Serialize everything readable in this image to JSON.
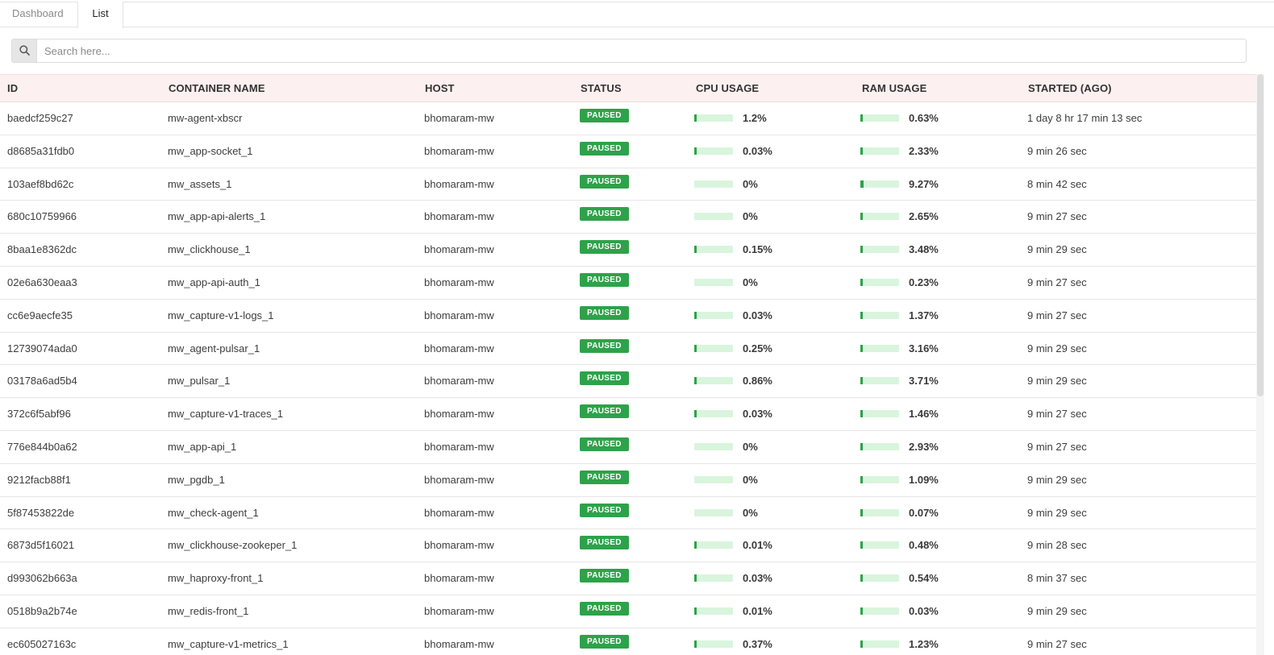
{
  "tabs": [
    {
      "label": "Dashboard",
      "active": false
    },
    {
      "label": "List",
      "active": true
    }
  ],
  "search": {
    "placeholder": "Search here...",
    "value": ""
  },
  "colors": {
    "status_paused": "#2ea24a",
    "meter_track": "#d9f5dd",
    "header_bg": "#fdf0f0"
  },
  "table": {
    "columns": [
      "ID",
      "CONTAINER NAME",
      "HOST",
      "STATUS",
      "CPU USAGE",
      "RAM USAGE",
      "STARTED (AGO)"
    ],
    "rows": [
      {
        "id": "baedcf259c27",
        "name": "mw-agent-xbscr",
        "host": "bhomaram-mw",
        "status": "PAUSED",
        "cpu": "1.2%",
        "cpu_value": 1.2,
        "ram": "0.63%",
        "ram_value": 0.63,
        "started": "1 day 8 hr 17 min 13 sec"
      },
      {
        "id": "d8685a31fdb0",
        "name": "mw_app-socket_1",
        "host": "bhomaram-mw",
        "status": "PAUSED",
        "cpu": "0.03%",
        "cpu_value": 0.03,
        "ram": "2.33%",
        "ram_value": 2.33,
        "started": "9 min 26 sec"
      },
      {
        "id": "103aef8bd62c",
        "name": "mw_assets_1",
        "host": "bhomaram-mw",
        "status": "PAUSED",
        "cpu": "0%",
        "cpu_value": 0,
        "ram": "9.27%",
        "ram_value": 9.27,
        "started": "8 min 42 sec"
      },
      {
        "id": "680c10759966",
        "name": "mw_app-api-alerts_1",
        "host": "bhomaram-mw",
        "status": "PAUSED",
        "cpu": "0%",
        "cpu_value": 0,
        "ram": "2.65%",
        "ram_value": 2.65,
        "started": "9 min 27 sec"
      },
      {
        "id": "8baa1e8362dc",
        "name": "mw_clickhouse_1",
        "host": "bhomaram-mw",
        "status": "PAUSED",
        "cpu": "0.15%",
        "cpu_value": 0.15,
        "ram": "3.48%",
        "ram_value": 3.48,
        "started": "9 min 29 sec"
      },
      {
        "id": "02e6a630eaa3",
        "name": "mw_app-api-auth_1",
        "host": "bhomaram-mw",
        "status": "PAUSED",
        "cpu": "0%",
        "cpu_value": 0,
        "ram": "0.23%",
        "ram_value": 0.23,
        "started": "9 min 27 sec"
      },
      {
        "id": "cc6e9aecfe35",
        "name": "mw_capture-v1-logs_1",
        "host": "bhomaram-mw",
        "status": "PAUSED",
        "cpu": "0.03%",
        "cpu_value": 0.03,
        "ram": "1.37%",
        "ram_value": 1.37,
        "started": "9 min 27 sec"
      },
      {
        "id": "12739074ada0",
        "name": "mw_agent-pulsar_1",
        "host": "bhomaram-mw",
        "status": "PAUSED",
        "cpu": "0.25%",
        "cpu_value": 0.25,
        "ram": "3.16%",
        "ram_value": 3.16,
        "started": "9 min 29 sec"
      },
      {
        "id": "03178a6ad5b4",
        "name": "mw_pulsar_1",
        "host": "bhomaram-mw",
        "status": "PAUSED",
        "cpu": "0.86%",
        "cpu_value": 0.86,
        "ram": "3.71%",
        "ram_value": 3.71,
        "started": "9 min 29 sec"
      },
      {
        "id": "372c6f5abf96",
        "name": "mw_capture-v1-traces_1",
        "host": "bhomaram-mw",
        "status": "PAUSED",
        "cpu": "0.03%",
        "cpu_value": 0.03,
        "ram": "1.46%",
        "ram_value": 1.46,
        "started": "9 min 27 sec"
      },
      {
        "id": "776e844b0a62",
        "name": "mw_app-api_1",
        "host": "bhomaram-mw",
        "status": "PAUSED",
        "cpu": "0%",
        "cpu_value": 0,
        "ram": "2.93%",
        "ram_value": 2.93,
        "started": "9 min 27 sec"
      },
      {
        "id": "9212facb88f1",
        "name": "mw_pgdb_1",
        "host": "bhomaram-mw",
        "status": "PAUSED",
        "cpu": "0%",
        "cpu_value": 0,
        "ram": "1.09%",
        "ram_value": 1.09,
        "started": "9 min 29 sec"
      },
      {
        "id": "5f87453822de",
        "name": "mw_check-agent_1",
        "host": "bhomaram-mw",
        "status": "PAUSED",
        "cpu": "0%",
        "cpu_value": 0,
        "ram": "0.07%",
        "ram_value": 0.07,
        "started": "9 min 29 sec"
      },
      {
        "id": "6873d5f16021",
        "name": "mw_clickhouse-zookeper_1",
        "host": "bhomaram-mw",
        "status": "PAUSED",
        "cpu": "0.01%",
        "cpu_value": 0.01,
        "ram": "0.48%",
        "ram_value": 0.48,
        "started": "9 min 28 sec"
      },
      {
        "id": "d993062b663a",
        "name": "mw_haproxy-front_1",
        "host": "bhomaram-mw",
        "status": "PAUSED",
        "cpu": "0.03%",
        "cpu_value": 0.03,
        "ram": "0.54%",
        "ram_value": 0.54,
        "started": "8 min 37 sec"
      },
      {
        "id": "0518b9a2b74e",
        "name": "mw_redis-front_1",
        "host": "bhomaram-mw",
        "status": "PAUSED",
        "cpu": "0.01%",
        "cpu_value": 0.01,
        "ram": "0.03%",
        "ram_value": 0.03,
        "started": "9 min 29 sec"
      },
      {
        "id": "ec605027163c",
        "name": "mw_capture-v1-metrics_1",
        "host": "bhomaram-mw",
        "status": "PAUSED",
        "cpu": "0.37%",
        "cpu_value": 0.37,
        "ram": "1.23%",
        "ram_value": 1.23,
        "started": "9 min 27 sec"
      }
    ]
  }
}
